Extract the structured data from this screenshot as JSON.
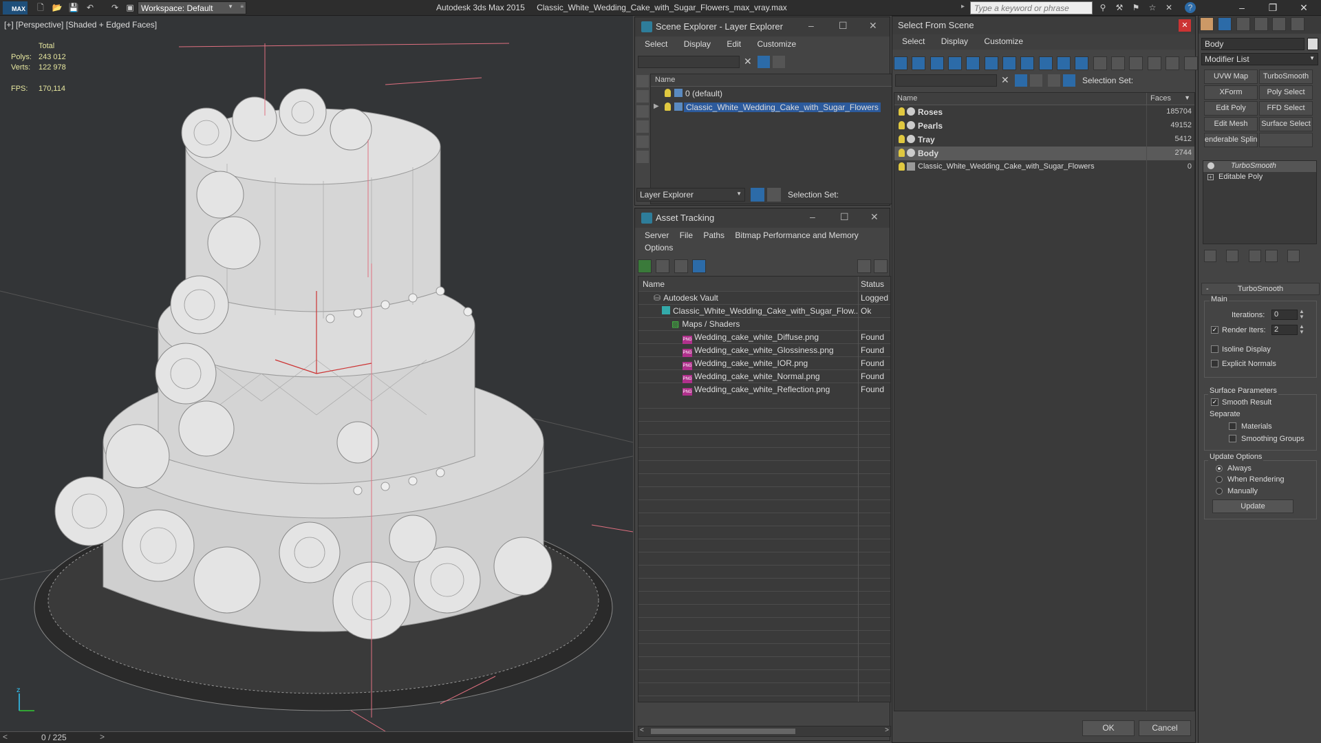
{
  "titlebar": {
    "app_title": "Autodesk 3ds Max 2015",
    "file_name": "Classic_White_Wedding_Cake_with_Sugar_Flowers_max_vray.max",
    "workspace_label": "Workspace: Default",
    "search_placeholder": "Type a keyword or phrase",
    "logo_text": "MAX"
  },
  "viewport": {
    "label": "[+] [Perspective] [Shaded + Edged Faces]",
    "stats": {
      "total_label": "Total",
      "polys_label": "Polys:",
      "polys_value": "243 012",
      "verts_label": "Verts:",
      "verts_value": "122 978",
      "fps_label": "FPS:",
      "fps_value": "170,114"
    },
    "timeline_frame": "0 / 225"
  },
  "scene_explorer": {
    "title": "Scene Explorer - Layer Explorer",
    "menu": [
      "Select",
      "Display",
      "Edit",
      "Customize"
    ],
    "column_name": "Name",
    "rows": [
      {
        "label": "0 (default)"
      },
      {
        "label": "Classic_White_Wedding_Cake_with_Sugar_Flowers"
      }
    ],
    "footer_dropdown": "Layer Explorer",
    "selection_set_label": "Selection Set:"
  },
  "asset_tracking": {
    "title": "Asset Tracking",
    "menu": [
      "Server",
      "File",
      "Paths",
      "Bitmap Performance and Memory"
    ],
    "menu2": [
      "Options"
    ],
    "columns": {
      "name": "Name",
      "status": "Status"
    },
    "rows": [
      {
        "name": "Autodesk Vault",
        "status": "Logged"
      },
      {
        "name": "Classic_White_Wedding_Cake_with_Sugar_Flow...",
        "status": "Ok"
      },
      {
        "name": "Maps / Shaders",
        "status": ""
      },
      {
        "name": "Wedding_cake_white_Diffuse.png",
        "status": "Found"
      },
      {
        "name": "Wedding_cake_white_Glossiness.png",
        "status": "Found"
      },
      {
        "name": "Wedding_cake_white_IOR.png",
        "status": "Found"
      },
      {
        "name": "Wedding_cake_white_Normal.png",
        "status": "Found"
      },
      {
        "name": "Wedding_cake_white_Reflection.png",
        "status": "Found"
      }
    ]
  },
  "select_from_scene": {
    "title": "Select From Scene",
    "menu": [
      "Select",
      "Display",
      "Customize"
    ],
    "selection_set_label": "Selection Set:",
    "columns": {
      "name": "Name",
      "faces": "Faces"
    },
    "rows": [
      {
        "name": "Roses",
        "faces": "185704"
      },
      {
        "name": "Pearls",
        "faces": "49152"
      },
      {
        "name": "Tray",
        "faces": "5412"
      },
      {
        "name": "Body",
        "faces": "2744"
      },
      {
        "name": "Classic_White_Wedding_Cake_with_Sugar_Flowers",
        "faces": "0"
      }
    ],
    "ok_label": "OK",
    "cancel_label": "Cancel"
  },
  "command_panel": {
    "object_name": "Body",
    "modifier_list": "Modifier List",
    "modifier_buttons": [
      "UVW Map",
      "TurboSmooth",
      "XForm",
      "Poly Select",
      "Edit Poly",
      "FFD Select",
      "Edit Mesh",
      "Surface Select",
      "enderable Splin",
      ""
    ],
    "stack": [
      "TurboSmooth",
      "Editable Poly"
    ],
    "rollout_title": "TurboSmooth",
    "main_label": "Main",
    "iterations_label": "Iterations:",
    "iterations_value": "0",
    "render_iters_label": "Render Iters:",
    "render_iters_value": "2",
    "isoline_label": "Isoline Display",
    "explicit_normals_label": "Explicit Normals",
    "surface_params_label": "Surface Parameters",
    "smooth_result_label": "Smooth Result",
    "separate_label": "Separate",
    "materials_label": "Materials",
    "smoothing_groups_label": "Smoothing Groups",
    "update_options_label": "Update Options",
    "always_label": "Always",
    "when_rendering_label": "When Rendering",
    "manually_label": "Manually",
    "update_button": "Update"
  }
}
